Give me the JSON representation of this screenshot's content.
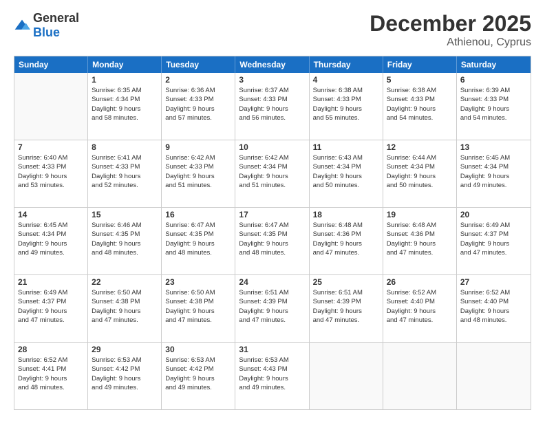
{
  "logo": {
    "general": "General",
    "blue": "Blue"
  },
  "title": "December 2025",
  "subtitle": "Athienou, Cyprus",
  "header_days": [
    "Sunday",
    "Monday",
    "Tuesday",
    "Wednesday",
    "Thursday",
    "Friday",
    "Saturday"
  ],
  "weeks": [
    [
      {
        "day": "",
        "lines": []
      },
      {
        "day": "1",
        "lines": [
          "Sunrise: 6:35 AM",
          "Sunset: 4:34 PM",
          "Daylight: 9 hours",
          "and 58 minutes."
        ]
      },
      {
        "day": "2",
        "lines": [
          "Sunrise: 6:36 AM",
          "Sunset: 4:33 PM",
          "Daylight: 9 hours",
          "and 57 minutes."
        ]
      },
      {
        "day": "3",
        "lines": [
          "Sunrise: 6:37 AM",
          "Sunset: 4:33 PM",
          "Daylight: 9 hours",
          "and 56 minutes."
        ]
      },
      {
        "day": "4",
        "lines": [
          "Sunrise: 6:38 AM",
          "Sunset: 4:33 PM",
          "Daylight: 9 hours",
          "and 55 minutes."
        ]
      },
      {
        "day": "5",
        "lines": [
          "Sunrise: 6:38 AM",
          "Sunset: 4:33 PM",
          "Daylight: 9 hours",
          "and 54 minutes."
        ]
      },
      {
        "day": "6",
        "lines": [
          "Sunrise: 6:39 AM",
          "Sunset: 4:33 PM",
          "Daylight: 9 hours",
          "and 54 minutes."
        ]
      }
    ],
    [
      {
        "day": "7",
        "lines": [
          "Sunrise: 6:40 AM",
          "Sunset: 4:33 PM",
          "Daylight: 9 hours",
          "and 53 minutes."
        ]
      },
      {
        "day": "8",
        "lines": [
          "Sunrise: 6:41 AM",
          "Sunset: 4:33 PM",
          "Daylight: 9 hours",
          "and 52 minutes."
        ]
      },
      {
        "day": "9",
        "lines": [
          "Sunrise: 6:42 AM",
          "Sunset: 4:33 PM",
          "Daylight: 9 hours",
          "and 51 minutes."
        ]
      },
      {
        "day": "10",
        "lines": [
          "Sunrise: 6:42 AM",
          "Sunset: 4:34 PM",
          "Daylight: 9 hours",
          "and 51 minutes."
        ]
      },
      {
        "day": "11",
        "lines": [
          "Sunrise: 6:43 AM",
          "Sunset: 4:34 PM",
          "Daylight: 9 hours",
          "and 50 minutes."
        ]
      },
      {
        "day": "12",
        "lines": [
          "Sunrise: 6:44 AM",
          "Sunset: 4:34 PM",
          "Daylight: 9 hours",
          "and 50 minutes."
        ]
      },
      {
        "day": "13",
        "lines": [
          "Sunrise: 6:45 AM",
          "Sunset: 4:34 PM",
          "Daylight: 9 hours",
          "and 49 minutes."
        ]
      }
    ],
    [
      {
        "day": "14",
        "lines": [
          "Sunrise: 6:45 AM",
          "Sunset: 4:34 PM",
          "Daylight: 9 hours",
          "and 49 minutes."
        ]
      },
      {
        "day": "15",
        "lines": [
          "Sunrise: 6:46 AM",
          "Sunset: 4:35 PM",
          "Daylight: 9 hours",
          "and 48 minutes."
        ]
      },
      {
        "day": "16",
        "lines": [
          "Sunrise: 6:47 AM",
          "Sunset: 4:35 PM",
          "Daylight: 9 hours",
          "and 48 minutes."
        ]
      },
      {
        "day": "17",
        "lines": [
          "Sunrise: 6:47 AM",
          "Sunset: 4:35 PM",
          "Daylight: 9 hours",
          "and 48 minutes."
        ]
      },
      {
        "day": "18",
        "lines": [
          "Sunrise: 6:48 AM",
          "Sunset: 4:36 PM",
          "Daylight: 9 hours",
          "and 47 minutes."
        ]
      },
      {
        "day": "19",
        "lines": [
          "Sunrise: 6:48 AM",
          "Sunset: 4:36 PM",
          "Daylight: 9 hours",
          "and 47 minutes."
        ]
      },
      {
        "day": "20",
        "lines": [
          "Sunrise: 6:49 AM",
          "Sunset: 4:37 PM",
          "Daylight: 9 hours",
          "and 47 minutes."
        ]
      }
    ],
    [
      {
        "day": "21",
        "lines": [
          "Sunrise: 6:49 AM",
          "Sunset: 4:37 PM",
          "Daylight: 9 hours",
          "and 47 minutes."
        ]
      },
      {
        "day": "22",
        "lines": [
          "Sunrise: 6:50 AM",
          "Sunset: 4:38 PM",
          "Daylight: 9 hours",
          "and 47 minutes."
        ]
      },
      {
        "day": "23",
        "lines": [
          "Sunrise: 6:50 AM",
          "Sunset: 4:38 PM",
          "Daylight: 9 hours",
          "and 47 minutes."
        ]
      },
      {
        "day": "24",
        "lines": [
          "Sunrise: 6:51 AM",
          "Sunset: 4:39 PM",
          "Daylight: 9 hours",
          "and 47 minutes."
        ]
      },
      {
        "day": "25",
        "lines": [
          "Sunrise: 6:51 AM",
          "Sunset: 4:39 PM",
          "Daylight: 9 hours",
          "and 47 minutes."
        ]
      },
      {
        "day": "26",
        "lines": [
          "Sunrise: 6:52 AM",
          "Sunset: 4:40 PM",
          "Daylight: 9 hours",
          "and 47 minutes."
        ]
      },
      {
        "day": "27",
        "lines": [
          "Sunrise: 6:52 AM",
          "Sunset: 4:40 PM",
          "Daylight: 9 hours",
          "and 48 minutes."
        ]
      }
    ],
    [
      {
        "day": "28",
        "lines": [
          "Sunrise: 6:52 AM",
          "Sunset: 4:41 PM",
          "Daylight: 9 hours",
          "and 48 minutes."
        ]
      },
      {
        "day": "29",
        "lines": [
          "Sunrise: 6:53 AM",
          "Sunset: 4:42 PM",
          "Daylight: 9 hours",
          "and 49 minutes."
        ]
      },
      {
        "day": "30",
        "lines": [
          "Sunrise: 6:53 AM",
          "Sunset: 4:42 PM",
          "Daylight: 9 hours",
          "and 49 minutes."
        ]
      },
      {
        "day": "31",
        "lines": [
          "Sunrise: 6:53 AM",
          "Sunset: 4:43 PM",
          "Daylight: 9 hours",
          "and 49 minutes."
        ]
      },
      {
        "day": "",
        "lines": []
      },
      {
        "day": "",
        "lines": []
      },
      {
        "day": "",
        "lines": []
      }
    ]
  ]
}
